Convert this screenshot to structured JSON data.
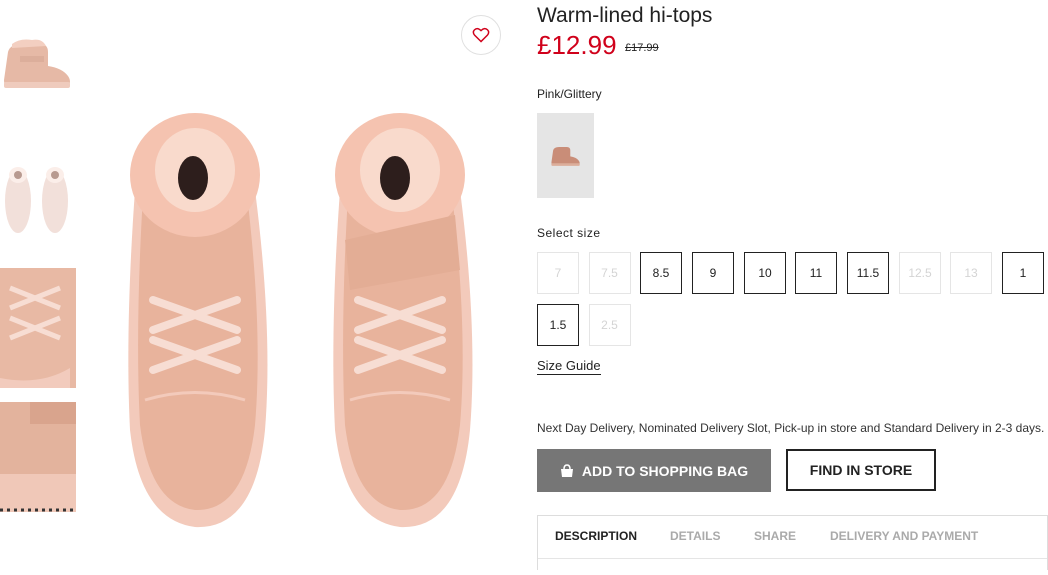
{
  "product": {
    "title": "Warm-lined hi-tops",
    "price": "£12.99",
    "old_price": "£17.99",
    "color_name": "Pink/Glittery"
  },
  "size_select": {
    "label": "Select size",
    "sizes": [
      {
        "label": "7",
        "available": false
      },
      {
        "label": "7.5",
        "available": false
      },
      {
        "label": "8.5",
        "available": true
      },
      {
        "label": "9",
        "available": true
      },
      {
        "label": "10",
        "available": true
      },
      {
        "label": "11",
        "available": true
      },
      {
        "label": "11.5",
        "available": true
      },
      {
        "label": "12.5",
        "available": false
      },
      {
        "label": "13",
        "available": false
      },
      {
        "label": "1",
        "available": true
      },
      {
        "label": "1.5",
        "available": true
      },
      {
        "label": "2.5",
        "available": false
      }
    ],
    "guide_label": "Size Guide"
  },
  "delivery_text": "Next Day Delivery, Nominated Delivery Slot, Pick-up in store and Standard Delivery in 2-3 days.",
  "buttons": {
    "add_to_bag": "ADD TO SHOPPING BAG",
    "find_in_store": "FIND IN STORE"
  },
  "tabs": [
    {
      "label": "DESCRIPTION",
      "active": true
    },
    {
      "label": "DETAILS",
      "active": false
    },
    {
      "label": "SHARE",
      "active": false
    },
    {
      "label": "DELIVERY AND PAYMENT",
      "active": false
    }
  ],
  "icons": {
    "favorite": "heart-icon",
    "bag": "shopping-bag-icon"
  },
  "colors": {
    "price_red": "#d0011b",
    "shoe_pink": "#e8b8a4",
    "button_grey": "#767676"
  }
}
